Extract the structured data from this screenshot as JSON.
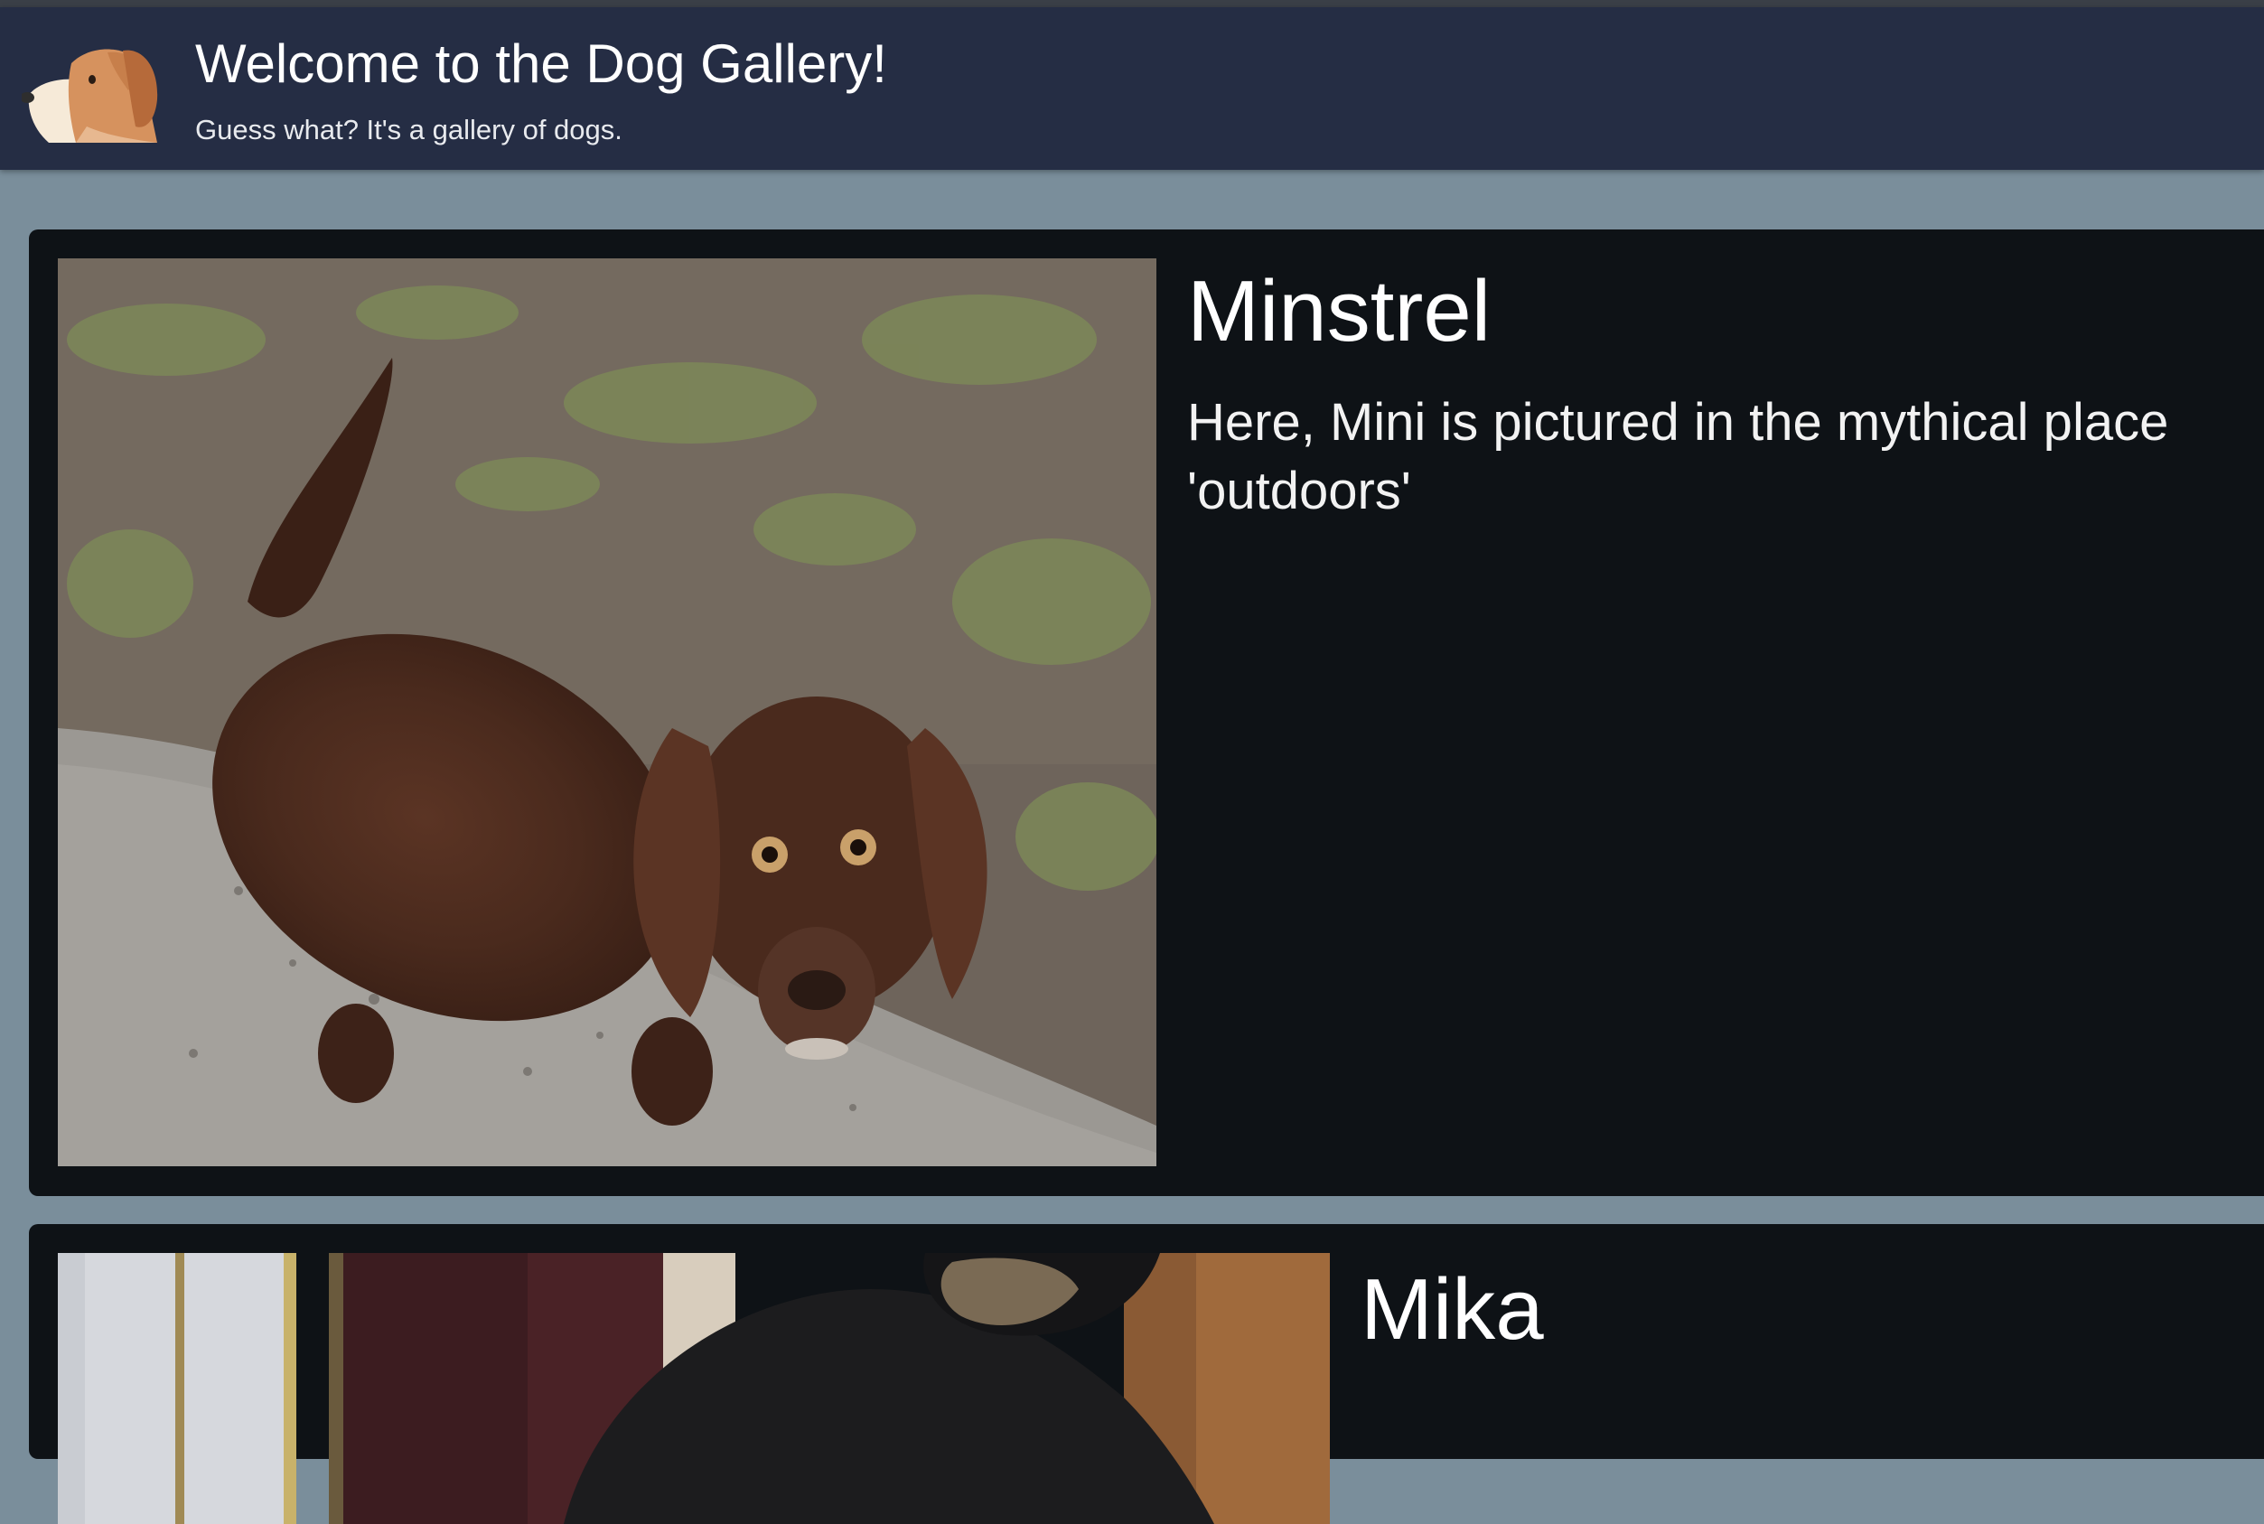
{
  "header": {
    "logo_icon": "dog-face-icon",
    "title": "Welcome to the Dog Gallery!",
    "subtitle": "Guess what? It's a gallery of dogs."
  },
  "gallery": {
    "items": [
      {
        "name": "Minstrel",
        "description": "Here, Mini is pictured in the mythical place 'outdoors'"
      },
      {
        "name": "Mika",
        "description": ""
      }
    ]
  },
  "colors": {
    "page_background": "#7a8e9b",
    "header_background": "#252d44",
    "card_background": "#0e1216",
    "text": "#ffffff"
  }
}
